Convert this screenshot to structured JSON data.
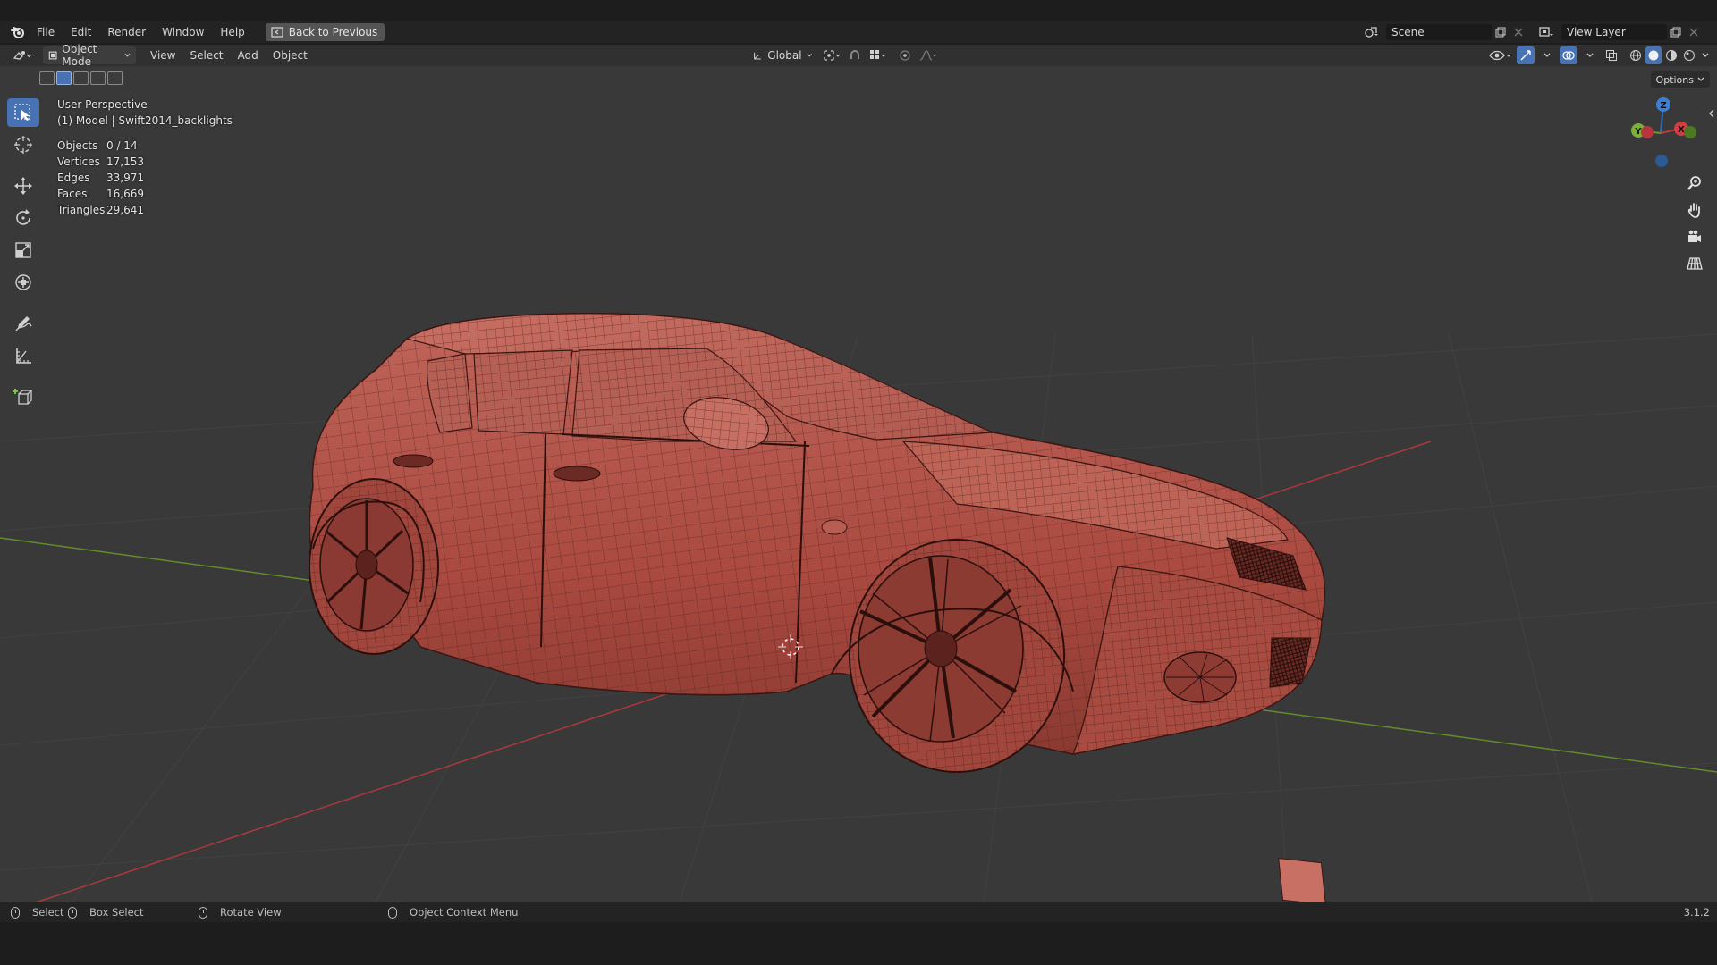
{
  "topbar": {
    "menus": [
      "File",
      "Edit",
      "Render",
      "Window",
      "Help"
    ],
    "back_label": "Back to Previous",
    "scene_value": "Scene",
    "view_layer_value": "View Layer"
  },
  "viewport_header": {
    "mode_label": "Object Mode",
    "menus": [
      "View",
      "Select",
      "Add",
      "Object"
    ],
    "orientation_label": "Global",
    "options_label": "Options"
  },
  "overlay": {
    "perspective": "User Perspective",
    "object_info": "(1) Model | Swift2014_backlights",
    "stats": [
      {
        "label": "Objects",
        "value": "0 / 14"
      },
      {
        "label": "Vertices",
        "value": "17,153"
      },
      {
        "label": "Edges",
        "value": "33,971"
      },
      {
        "label": "Faces",
        "value": "16,669"
      },
      {
        "label": "Triangles",
        "value": "29,641"
      }
    ]
  },
  "gizmo": {
    "z": "Z",
    "y": "Y",
    "x": "X"
  },
  "statusbar": {
    "select": "Select",
    "box_select": "Box Select",
    "rotate_view": "Rotate View",
    "context_menu": "Object Context Menu",
    "version": "3.1.2"
  },
  "colors": {
    "accent": "#4772b3",
    "mesh": "#b5564a",
    "x_axis": "#c0393f",
    "y_axis": "#6a9a2a"
  },
  "icons": [
    "blender-logo-icon",
    "back-icon",
    "scene-icon",
    "view-layer-icon",
    "cursor-tool-icon",
    "move-icon",
    "rotate-icon",
    "scale-icon",
    "transform-icon",
    "annotate-icon",
    "measure-icon",
    "add-cube-icon",
    "zoom-icon",
    "hand-icon",
    "camera-icon",
    "grid-icon"
  ]
}
